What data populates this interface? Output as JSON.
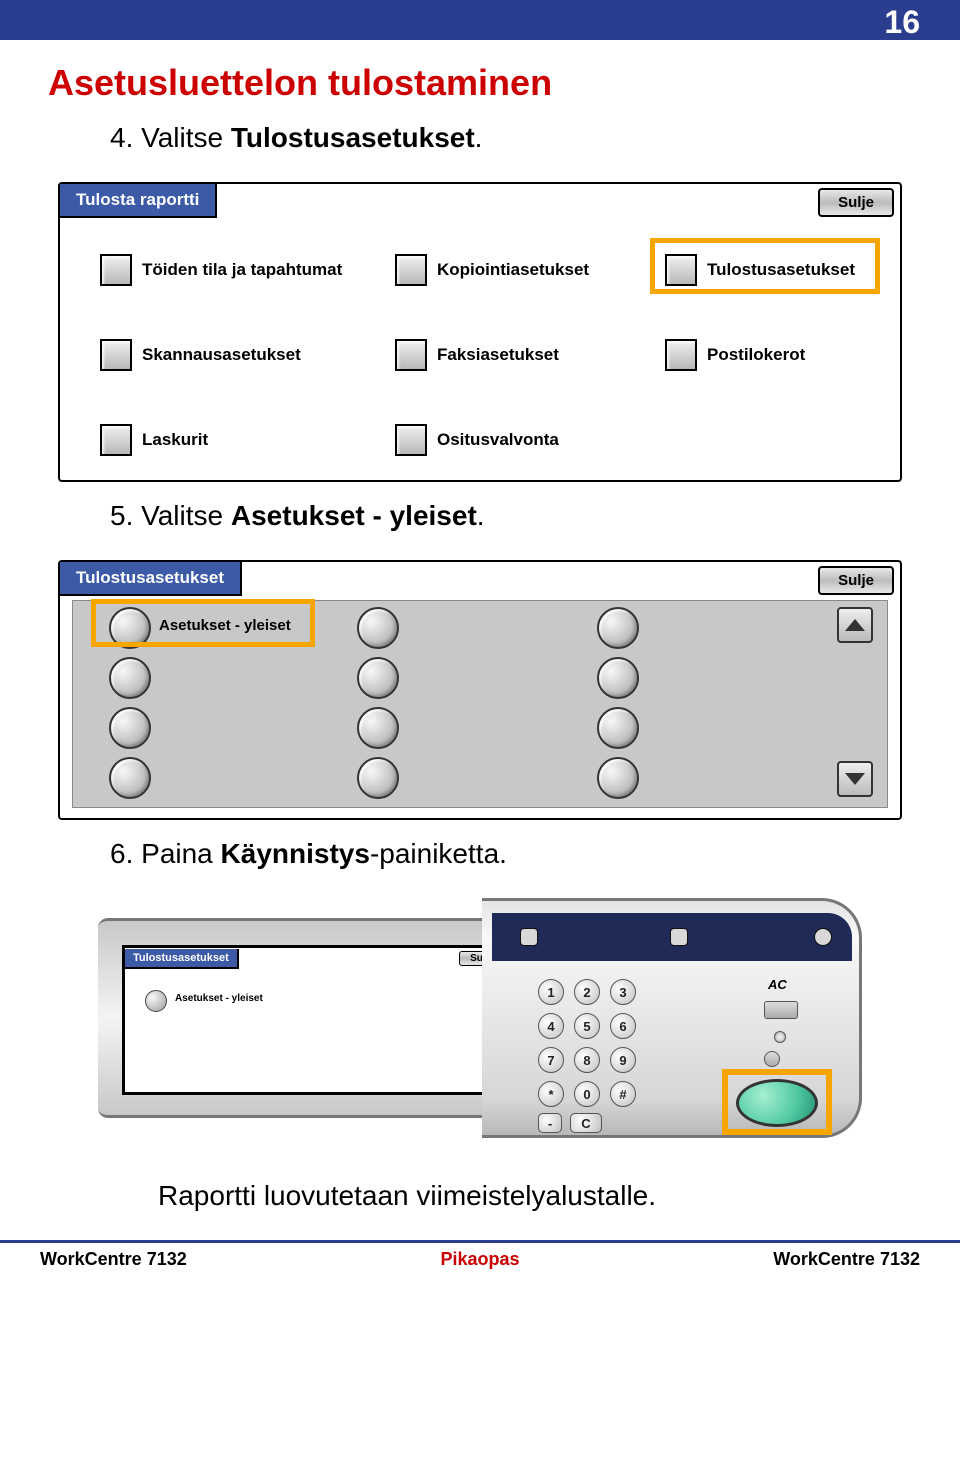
{
  "page_number": "16",
  "heading": "Asetusluettelon tulostaminen",
  "step4": {
    "num": "4.",
    "prefix": "Valitse ",
    "bold": "Tulostusasetukset",
    "suffix": "."
  },
  "panel1": {
    "title": "Tulosta raportti",
    "close": "Sulje",
    "options": [
      "Töiden tila ja tapahtumat",
      "Kopiointiasetukset",
      "Tulostusasetukset",
      "Skannausasetukset",
      "Faksiasetukset",
      "Postilokerot",
      "Laskurit",
      "Ositusvalvonta"
    ]
  },
  "step5": {
    "num": "5.",
    "prefix": "Valitse ",
    "bold": "Asetukset - yleiset",
    "suffix": "."
  },
  "panel2": {
    "title": "Tulostusasetukset",
    "close": "Sulje",
    "option": "Asetukset - yleiset"
  },
  "step6": {
    "num": "6.",
    "prefix": "Paina ",
    "bold": "Käynnistys",
    "suffix": "-painiketta."
  },
  "machine_screen": {
    "title": "Tulostusasetukset",
    "close": "Sulje",
    "option": "Asetukset - yleiset"
  },
  "keypad": [
    "1",
    "2",
    "3",
    "4",
    "5",
    "6",
    "7",
    "8",
    "9",
    "*",
    "0",
    "#"
  ],
  "keypad_extra": [
    "-",
    "C"
  ],
  "side_label": "AC",
  "bottom_text": "Raportti luovutetaan viimeistelyalustalle.",
  "footer": {
    "left": "WorkCentre 7132",
    "mid": "Pikaopas",
    "right": "WorkCentre 7132"
  }
}
